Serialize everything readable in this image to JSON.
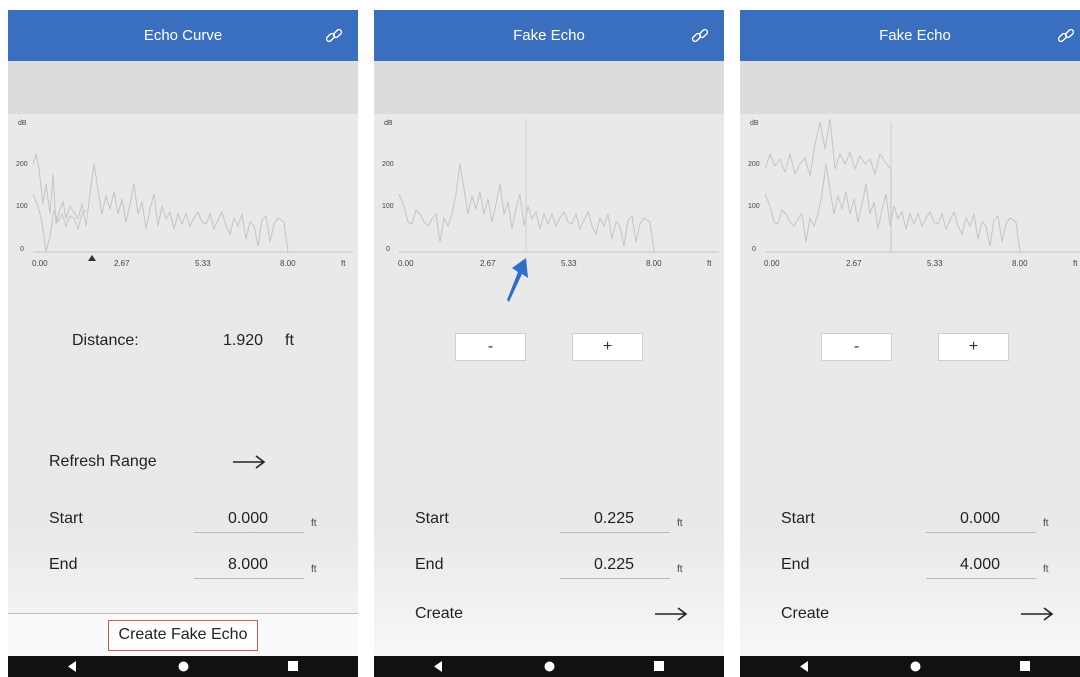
{
  "screens": [
    {
      "title": "Echo Curve",
      "chart": {
        "y_unit": "dB",
        "y_ticks": [
          "0",
          "100",
          "200"
        ],
        "x_ticks": [
          "0.00",
          "2.67",
          "5.33",
          "8.00"
        ],
        "x_unit": "ft"
      },
      "distance_label": "Distance:",
      "distance_value": "1.920",
      "distance_unit": "ft",
      "refresh_label": "Refresh Range",
      "start_label": "Start",
      "start_value": "0.000",
      "start_unit": "ft",
      "end_label": "End",
      "end_value": "8.000",
      "end_unit": "ft",
      "create_fake_echo_label": "Create Fake Echo"
    },
    {
      "title": "Fake Echo",
      "chart": {
        "y_unit": "dB",
        "y_ticks": [
          "0",
          "100",
          "200"
        ],
        "x_ticks": [
          "0.00",
          "2.67",
          "5.33",
          "8.00"
        ],
        "x_unit": "ft"
      },
      "minus_label": "-",
      "plus_label": "+",
      "start_label": "Start",
      "start_value": "0.225",
      "start_unit": "ft",
      "end_label": "End",
      "end_value": "0.225",
      "end_unit": "ft",
      "create_label": "Create"
    },
    {
      "title": "Fake Echo",
      "chart": {
        "y_unit": "dB",
        "y_ticks": [
          "0",
          "100",
          "200"
        ],
        "x_ticks": [
          "0.00",
          "2.67",
          "5.33",
          "8.00"
        ],
        "x_unit": "ft"
      },
      "minus_label": "-",
      "plus_label": "+",
      "start_label": "Start",
      "start_value": "0.000",
      "start_unit": "ft",
      "end_label": "End",
      "end_value": "4.000",
      "end_unit": "ft",
      "create_label": "Create"
    }
  ],
  "icons": {
    "title_action": "link-icon",
    "nav": [
      "back-icon",
      "home-icon",
      "recents-icon"
    ],
    "annotation": "pointer-arrow-icon"
  },
  "colors": {
    "app_bar": "#3a6fc0",
    "curve": "#c4c4c4",
    "highlight_box": "#d9534f",
    "annotation_arrow": "#2f6fc8"
  }
}
